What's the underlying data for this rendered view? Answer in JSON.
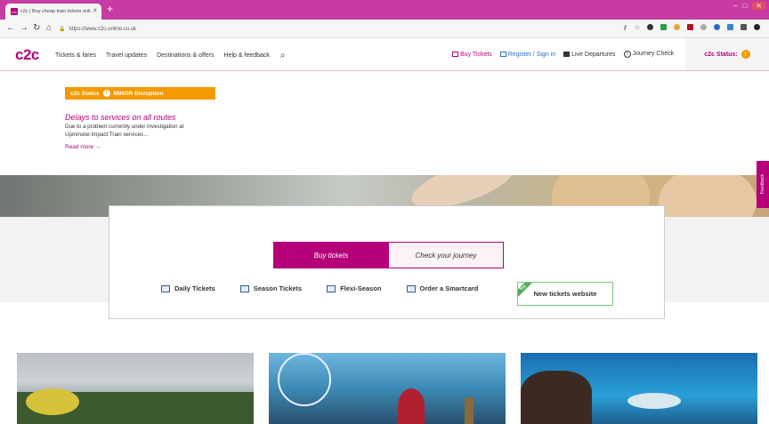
{
  "browser": {
    "tab_title": "c2c | Buy cheap train tickets onli…",
    "favicon_text": "c2c",
    "new_tab": "+",
    "url": "https://www.c2c-online.co.uk",
    "window_controls": [
      "–",
      "□",
      "✕"
    ]
  },
  "site": {
    "logo": "c2c",
    "menu": [
      "Tickets & fares",
      "Travel updates",
      "Destinations & offers",
      "Help & feedback"
    ],
    "right_menu": [
      {
        "label": "Buy Tickets",
        "icon": "ticket-icon"
      },
      {
        "label": "Register / Sign in",
        "icon": "sign-in-icon"
      },
      {
        "label": "Live Departures",
        "icon": "departures-board-icon"
      },
      {
        "label": "Journey Check",
        "icon": "info-icon"
      }
    ],
    "status_label": "c2c Status:",
    "status_icon": "!"
  },
  "alert": {
    "banner": "c2c Status",
    "level": "MINOR Disruption",
    "icon": "!",
    "headline": "Delays to services on all routes",
    "body": "Due to a problem currently under investigation at Upminster.Impact:Train services…",
    "read_more": "Read more",
    "arrow": "→"
  },
  "feedback_tab": "Feedback",
  "booking": {
    "tab_buy": "Buy tickets",
    "tab_check": "Check your journey",
    "links": [
      "Daily Tickets",
      "Season Tickets",
      "Flexi-Season",
      "Order a Smartcard"
    ],
    "new_site_badge": "Try",
    "new_site_label": "New tickets website"
  },
  "colors": {
    "brand": "#b5007a",
    "status": "#f49a00",
    "try_badge": "#4caf50"
  }
}
